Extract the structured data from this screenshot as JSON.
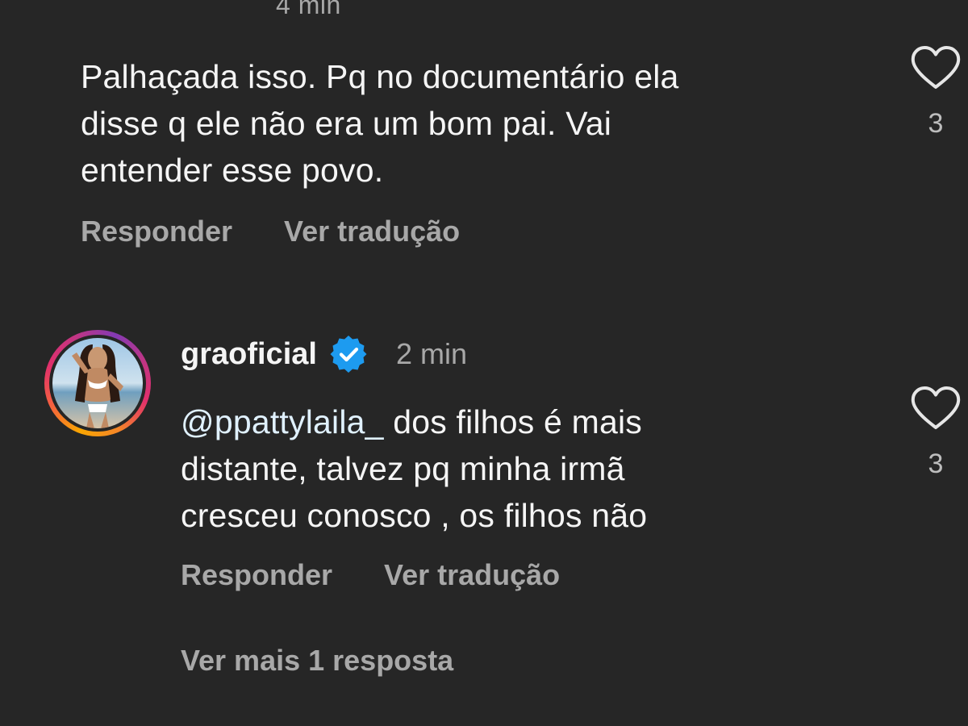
{
  "comment1": {
    "time": "4 min",
    "text_line1": "Palhaçada isso. Pq no documentário ela",
    "text_line2": "disse q ele não  era um bom pai. Vai",
    "text_line3": "entender esse povo.",
    "reply_label": "Responder",
    "translate_label": "Ver tradução",
    "likes": "3"
  },
  "comment2": {
    "username": "graoficial",
    "verified": true,
    "time": "2 min",
    "mention": "@ppattylaila_",
    "text_line1_rest": " dos filhos é mais",
    "text_line2": "distante, talvez pq minha irmã",
    "text_line3": "cresceu conosco , os filhos não",
    "reply_label": "Responder",
    "translate_label": "Ver tradução",
    "likes": "3",
    "more_replies": "Ver mais 1 resposta"
  },
  "icons": {
    "like": "heart-outline-icon",
    "verified": "verified-badge-icon"
  },
  "colors": {
    "background": "#262626",
    "secondary_text": "#a8a8a8",
    "verified_blue": "#1d9bf0"
  }
}
